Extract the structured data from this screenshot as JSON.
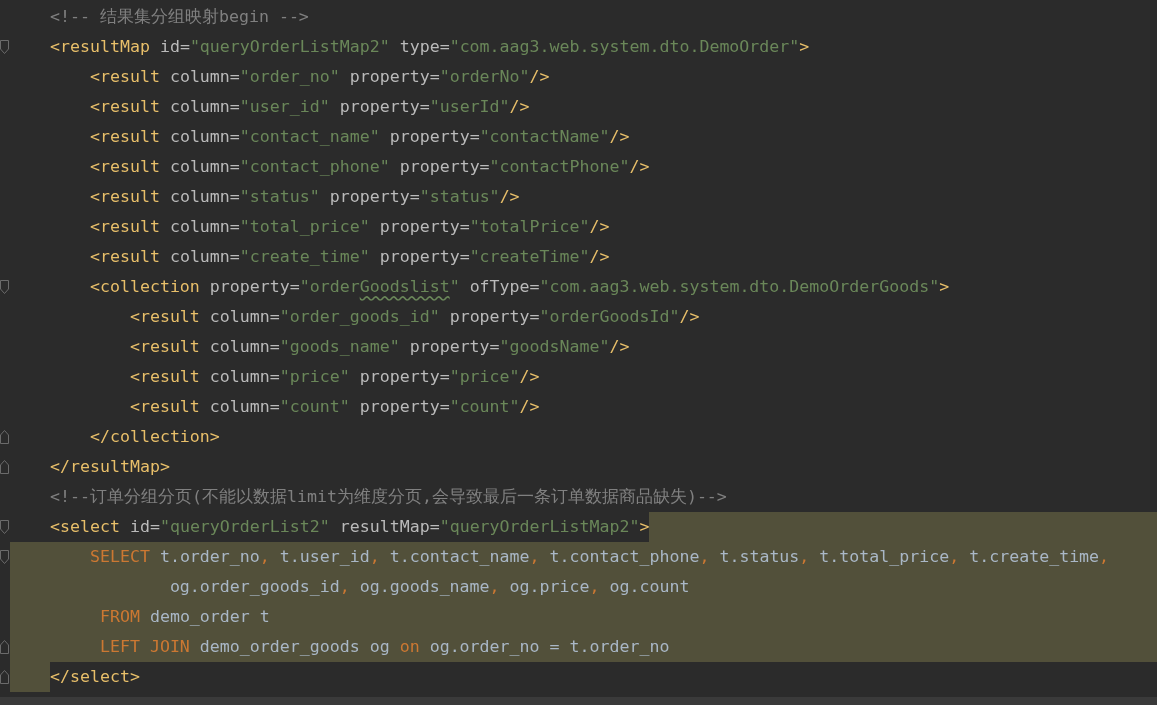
{
  "editor": {
    "lines": [
      {
        "fold_start": false,
        "fold_end": false,
        "selected_margin": false,
        "selected_text": false,
        "selected_tail": false,
        "tokens": [
          {
            "kind": "comment",
            "text": "<!-- 结果集分组映射begin -->"
          }
        ]
      },
      {
        "fold_start": true,
        "fold_end": false,
        "selected_margin": false,
        "selected_text": false,
        "selected_tail": false,
        "tokens": [
          {
            "kind": "tag",
            "text": "<resultMap"
          },
          {
            "kind": "attr",
            "text": " id="
          },
          {
            "kind": "string",
            "text": "\"queryOrderListMap2\""
          },
          {
            "kind": "attr",
            "text": " type="
          },
          {
            "kind": "string",
            "text": "\"com.aag3.web.system.dto.DemoOrder\""
          },
          {
            "kind": "tag",
            "text": ">"
          }
        ]
      },
      {
        "fold_start": false,
        "fold_end": false,
        "selected_margin": false,
        "selected_text": false,
        "selected_tail": false,
        "tokens": [
          {
            "kind": "tag",
            "text": "    <result"
          },
          {
            "kind": "attr",
            "text": " column="
          },
          {
            "kind": "string",
            "text": "\"order_no\""
          },
          {
            "kind": "attr",
            "text": " property="
          },
          {
            "kind": "string",
            "text": "\"orderNo\""
          },
          {
            "kind": "tag",
            "text": "/>"
          }
        ]
      },
      {
        "fold_start": false,
        "fold_end": false,
        "selected_margin": false,
        "selected_text": false,
        "selected_tail": false,
        "tokens": [
          {
            "kind": "tag",
            "text": "    <result"
          },
          {
            "kind": "attr",
            "text": " column="
          },
          {
            "kind": "string",
            "text": "\"user_id\""
          },
          {
            "kind": "attr",
            "text": " property="
          },
          {
            "kind": "string",
            "text": "\"userId\""
          },
          {
            "kind": "tag",
            "text": "/>"
          }
        ]
      },
      {
        "fold_start": false,
        "fold_end": false,
        "selected_margin": false,
        "selected_text": false,
        "selected_tail": false,
        "tokens": [
          {
            "kind": "tag",
            "text": "    <result"
          },
          {
            "kind": "attr",
            "text": " column="
          },
          {
            "kind": "string",
            "text": "\"contact_name\""
          },
          {
            "kind": "attr",
            "text": " property="
          },
          {
            "kind": "string",
            "text": "\"contactName\""
          },
          {
            "kind": "tag",
            "text": "/>"
          }
        ]
      },
      {
        "fold_start": false,
        "fold_end": false,
        "selected_margin": false,
        "selected_text": false,
        "selected_tail": false,
        "tokens": [
          {
            "kind": "tag",
            "text": "    <result"
          },
          {
            "kind": "attr",
            "text": " column="
          },
          {
            "kind": "string",
            "text": "\"contact_phone\""
          },
          {
            "kind": "attr",
            "text": " property="
          },
          {
            "kind": "string",
            "text": "\"contactPhone\""
          },
          {
            "kind": "tag",
            "text": "/>"
          }
        ]
      },
      {
        "fold_start": false,
        "fold_end": false,
        "selected_margin": false,
        "selected_text": false,
        "selected_tail": false,
        "tokens": [
          {
            "kind": "tag",
            "text": "    <result"
          },
          {
            "kind": "attr",
            "text": " column="
          },
          {
            "kind": "string",
            "text": "\"status\""
          },
          {
            "kind": "attr",
            "text": " property="
          },
          {
            "kind": "string",
            "text": "\"status\""
          },
          {
            "kind": "tag",
            "text": "/>"
          }
        ]
      },
      {
        "fold_start": false,
        "fold_end": false,
        "selected_margin": false,
        "selected_text": false,
        "selected_tail": false,
        "tokens": [
          {
            "kind": "tag",
            "text": "    <result"
          },
          {
            "kind": "attr",
            "text": " column="
          },
          {
            "kind": "string",
            "text": "\"total_price\""
          },
          {
            "kind": "attr",
            "text": " property="
          },
          {
            "kind": "string",
            "text": "\"totalPrice\""
          },
          {
            "kind": "tag",
            "text": "/>"
          }
        ]
      },
      {
        "fold_start": false,
        "fold_end": false,
        "selected_margin": false,
        "selected_text": false,
        "selected_tail": false,
        "tokens": [
          {
            "kind": "tag",
            "text": "    <result"
          },
          {
            "kind": "attr",
            "text": " column="
          },
          {
            "kind": "string",
            "text": "\"create_time\""
          },
          {
            "kind": "attr",
            "text": " property="
          },
          {
            "kind": "string",
            "text": "\"createTime\""
          },
          {
            "kind": "tag",
            "text": "/>"
          }
        ]
      },
      {
        "fold_start": true,
        "fold_end": false,
        "selected_margin": false,
        "selected_text": false,
        "selected_tail": false,
        "tokens": [
          {
            "kind": "tag",
            "text": "    <collection"
          },
          {
            "kind": "attr",
            "text": " property="
          },
          {
            "kind": "string",
            "text": "\"order"
          },
          {
            "kind": "string",
            "text": "Goodslist",
            "misspelled": true
          },
          {
            "kind": "string",
            "text": "\""
          },
          {
            "kind": "attr",
            "text": " ofType="
          },
          {
            "kind": "string",
            "text": "\"com.aag3.web.system.dto.DemoOrderGoods\""
          },
          {
            "kind": "tag",
            "text": ">"
          }
        ]
      },
      {
        "fold_start": false,
        "fold_end": false,
        "selected_margin": false,
        "selected_text": false,
        "selected_tail": false,
        "tokens": [
          {
            "kind": "tag",
            "text": "        <result"
          },
          {
            "kind": "attr",
            "text": " column="
          },
          {
            "kind": "string",
            "text": "\"order_goods_id\""
          },
          {
            "kind": "attr",
            "text": " property="
          },
          {
            "kind": "string",
            "text": "\"orderGoodsId\""
          },
          {
            "kind": "tag",
            "text": "/>"
          }
        ]
      },
      {
        "fold_start": false,
        "fold_end": false,
        "selected_margin": false,
        "selected_text": false,
        "selected_tail": false,
        "tokens": [
          {
            "kind": "tag",
            "text": "        <result"
          },
          {
            "kind": "attr",
            "text": " column="
          },
          {
            "kind": "string",
            "text": "\"goods_name\""
          },
          {
            "kind": "attr",
            "text": " property="
          },
          {
            "kind": "string",
            "text": "\"goodsName\""
          },
          {
            "kind": "tag",
            "text": "/>"
          }
        ]
      },
      {
        "fold_start": false,
        "fold_end": false,
        "selected_margin": false,
        "selected_text": false,
        "selected_tail": false,
        "tokens": [
          {
            "kind": "tag",
            "text": "        <result"
          },
          {
            "kind": "attr",
            "text": " column="
          },
          {
            "kind": "string",
            "text": "\"price\""
          },
          {
            "kind": "attr",
            "text": " property="
          },
          {
            "kind": "string",
            "text": "\"price\""
          },
          {
            "kind": "tag",
            "text": "/>"
          }
        ]
      },
      {
        "fold_start": false,
        "fold_end": false,
        "selected_margin": false,
        "selected_text": false,
        "selected_tail": false,
        "tokens": [
          {
            "kind": "tag",
            "text": "        <result"
          },
          {
            "kind": "attr",
            "text": " column="
          },
          {
            "kind": "string",
            "text": "\"count\""
          },
          {
            "kind": "attr",
            "text": " property="
          },
          {
            "kind": "string",
            "text": "\"count\""
          },
          {
            "kind": "tag",
            "text": "/>"
          }
        ]
      },
      {
        "fold_start": false,
        "fold_end": true,
        "selected_margin": false,
        "selected_text": false,
        "selected_tail": false,
        "tokens": [
          {
            "kind": "tag",
            "text": "    </collection>"
          }
        ]
      },
      {
        "fold_start": false,
        "fold_end": true,
        "selected_margin": false,
        "selected_text": false,
        "selected_tail": false,
        "tokens": [
          {
            "kind": "tag",
            "text": "</resultMap>"
          }
        ]
      },
      {
        "fold_start": false,
        "fold_end": false,
        "selected_margin": false,
        "selected_text": false,
        "selected_tail": false,
        "tokens": [
          {
            "kind": "comment",
            "text": "<!--订单分组分页(不能以数据limit为维度分页,会导致最后一条订单数据商品缺失)-->"
          }
        ]
      },
      {
        "fold_start": true,
        "fold_end": false,
        "selected_margin": false,
        "selected_text": false,
        "selected_tail": true,
        "tokens": [
          {
            "kind": "tag",
            "text": "<select"
          },
          {
            "kind": "attr",
            "text": " id="
          },
          {
            "kind": "string",
            "text": "\"queryOrderList2\""
          },
          {
            "kind": "attr",
            "text": " resultMap="
          },
          {
            "kind": "string",
            "text": "\"queryOrderListMap2\""
          },
          {
            "kind": "tag",
            "text": ">"
          }
        ]
      },
      {
        "fold_start": true,
        "fold_end": false,
        "selected_margin": true,
        "selected_text": true,
        "selected_tail": true,
        "tokens": [
          {
            "kind": "keyword",
            "text": "    SELECT"
          },
          {
            "kind": "code",
            "text": " t.order_no"
          },
          {
            "kind": "keyword",
            "text": ","
          },
          {
            "kind": "code",
            "text": " t.user_id"
          },
          {
            "kind": "keyword",
            "text": ","
          },
          {
            "kind": "code",
            "text": " t.contact_name"
          },
          {
            "kind": "keyword",
            "text": ","
          },
          {
            "kind": "code",
            "text": " t.contact_phone"
          },
          {
            "kind": "keyword",
            "text": ","
          },
          {
            "kind": "code",
            "text": " t.status"
          },
          {
            "kind": "keyword",
            "text": ","
          },
          {
            "kind": "code",
            "text": " t.total_price"
          },
          {
            "kind": "keyword",
            "text": ","
          },
          {
            "kind": "code",
            "text": " t.create_time"
          },
          {
            "kind": "keyword",
            "text": ","
          }
        ]
      },
      {
        "fold_start": false,
        "fold_end": false,
        "selected_margin": true,
        "selected_text": true,
        "selected_tail": true,
        "tokens": [
          {
            "kind": "code",
            "text": "            og.order_goods_id"
          },
          {
            "kind": "keyword",
            "text": ","
          },
          {
            "kind": "code",
            "text": " og.goods_name"
          },
          {
            "kind": "keyword",
            "text": ","
          },
          {
            "kind": "code",
            "text": " og.price"
          },
          {
            "kind": "keyword",
            "text": ","
          },
          {
            "kind": "code",
            "text": " og.count"
          }
        ]
      },
      {
        "fold_start": false,
        "fold_end": false,
        "selected_margin": true,
        "selected_text": true,
        "selected_tail": true,
        "tokens": [
          {
            "kind": "keyword",
            "text": "     FROM"
          },
          {
            "kind": "code",
            "text": " demo_order t"
          }
        ]
      },
      {
        "fold_start": false,
        "fold_end": true,
        "selected_margin": true,
        "selected_text": true,
        "selected_tail": true,
        "tokens": [
          {
            "kind": "keyword",
            "text": "     LEFT JOIN"
          },
          {
            "kind": "code",
            "text": " demo_order_goods og "
          },
          {
            "kind": "keyword",
            "text": "on"
          },
          {
            "kind": "code",
            "text": " og.order_no = t.order_no"
          }
        ]
      },
      {
        "fold_start": false,
        "fold_end": true,
        "selected_margin": true,
        "selected_text": false,
        "selected_tail": false,
        "tokens": [
          {
            "kind": "tag",
            "text": "</select>"
          }
        ]
      }
    ]
  }
}
